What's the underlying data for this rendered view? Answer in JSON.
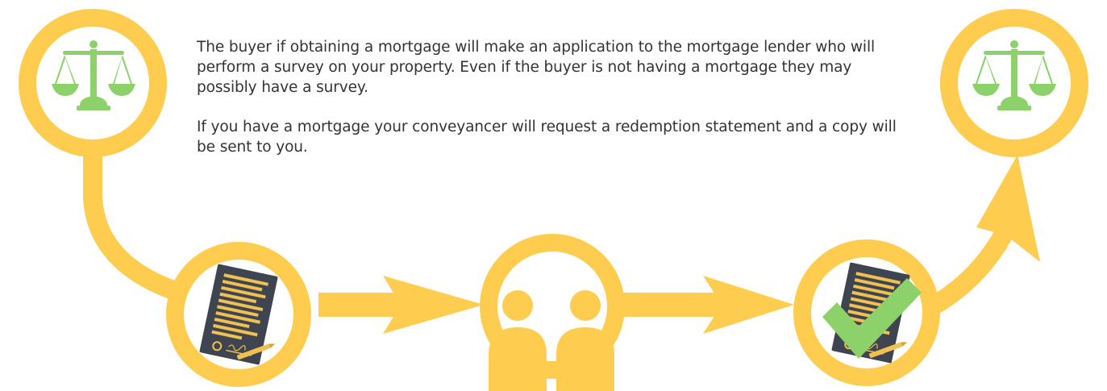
{
  "description": {
    "paragraph_1": "The buyer if obtaining a mortgage will make an application to the mortgage lender who will perform a survey on your property. Even if the buyer is not having a mortgage they may possibly have a survey.",
    "paragraph_2": "If you have a mortgage your conveyancer will request a redemption statement and a copy will be sent to you."
  },
  "colors": {
    "path": "#fecc4f",
    "icon_green": "#8dd16b",
    "document_dark": "#3e4450",
    "document_lines": "#f0c050",
    "check_green": "#8dd16b"
  },
  "icons": {
    "step_1": "scales-of-justice-icon",
    "step_2": "signed-document-icon",
    "step_3": "two-people-icon",
    "step_4": "approved-document-icon",
    "step_5": "scales-of-justice-icon"
  }
}
